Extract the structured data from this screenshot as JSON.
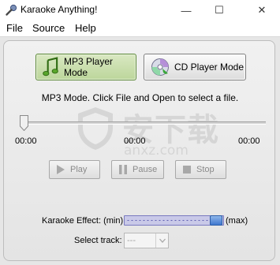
{
  "window": {
    "title": "Karaoke Anything!",
    "minimize_glyph": "—",
    "maximize_glyph": "☐",
    "close_glyph": "✕"
  },
  "menu": {
    "file": "File",
    "source": "Source",
    "help": "Help"
  },
  "modes": {
    "mp3_label": "MP3 Player Mode",
    "cd_label": "CD Player Mode",
    "active": "mp3"
  },
  "status": "MP3 Mode. Click File and Open to select a file.",
  "position": {
    "start": "00:00",
    "current": "00:00",
    "end": "00:00",
    "progress": 0
  },
  "transport": {
    "play": "Play",
    "pause": "Pause",
    "stop": "Stop",
    "enabled": false
  },
  "karaoke_effect": {
    "label": "Karaoke Effect: (min)",
    "max_label": "(max)",
    "level": 1.0
  },
  "track": {
    "label": "Select track:",
    "value": "---",
    "enabled": false
  },
  "watermark": {
    "text": "安下载",
    "sub": "anxz.com"
  },
  "colors": {
    "active_mode": "#bcd69b",
    "effect_slider": "#c9c9e8",
    "effect_thumb": "#3f78cf",
    "disabled_text": "#8a8a8a"
  }
}
